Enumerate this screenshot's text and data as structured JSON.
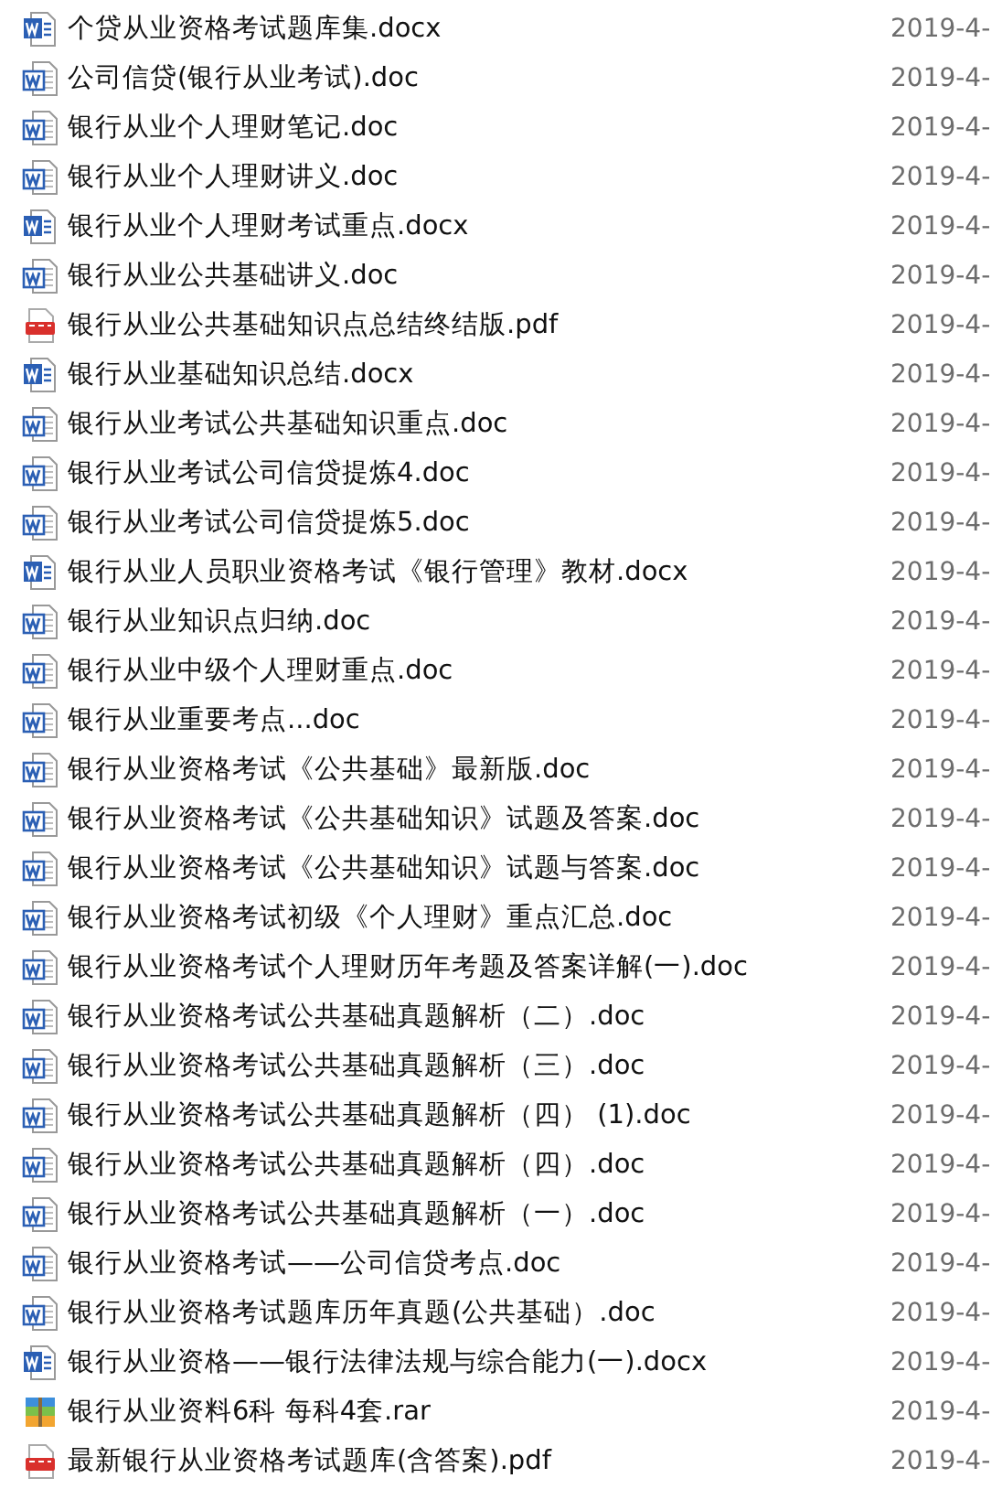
{
  "files": [
    {
      "kind": "docx",
      "name": "个贷从业资格考试题库集.docx",
      "date": "2019-4-"
    },
    {
      "kind": "doc",
      "name": "公司信贷(银行从业考试).doc",
      "date": "2019-4-"
    },
    {
      "kind": "doc",
      "name": "银行从业个人理财笔记.doc",
      "date": "2019-4-"
    },
    {
      "kind": "doc",
      "name": "银行从业个人理财讲义.doc",
      "date": "2019-4-"
    },
    {
      "kind": "docx",
      "name": "银行从业个人理财考试重点.docx",
      "date": "2019-4-"
    },
    {
      "kind": "doc",
      "name": "银行从业公共基础讲义.doc",
      "date": "2019-4-"
    },
    {
      "kind": "pdf",
      "name": "银行从业公共基础知识点总结终结版.pdf",
      "date": "2019-4-"
    },
    {
      "kind": "docx",
      "name": "银行从业基础知识总结.docx",
      "date": "2019-4-"
    },
    {
      "kind": "doc",
      "name": "银行从业考试公共基础知识重点.doc",
      "date": "2019-4-"
    },
    {
      "kind": "doc",
      "name": "银行从业考试公司信贷提炼4.doc",
      "date": "2019-4-"
    },
    {
      "kind": "doc",
      "name": "银行从业考试公司信贷提炼5.doc",
      "date": "2019-4-"
    },
    {
      "kind": "docx",
      "name": "银行从业人员职业资格考试《银行管理》教材.docx",
      "date": "2019-4-"
    },
    {
      "kind": "doc",
      "name": "银行从业知识点归纳.doc",
      "date": "2019-4-"
    },
    {
      "kind": "doc",
      "name": "银行从业中级个人理财重点.doc",
      "date": "2019-4-"
    },
    {
      "kind": "doc",
      "name": "银行从业重要考点...doc",
      "date": "2019-4-"
    },
    {
      "kind": "doc",
      "name": "银行从业资格考试《公共基础》最新版.doc",
      "date": "2019-4-"
    },
    {
      "kind": "doc",
      "name": "银行从业资格考试《公共基础知识》试题及答案.doc",
      "date": "2019-4-"
    },
    {
      "kind": "doc",
      "name": "银行从业资格考试《公共基础知识》试题与答案.doc",
      "date": "2019-4-"
    },
    {
      "kind": "doc",
      "name": "银行从业资格考试初级《个人理财》重点汇总.doc",
      "date": "2019-4-"
    },
    {
      "kind": "doc",
      "name": "银行从业资格考试个人理财历年考题及答案详解(一).doc",
      "date": "2019-4-"
    },
    {
      "kind": "doc",
      "name": "银行从业资格考试公共基础真题解析（二）.doc",
      "date": "2019-4-"
    },
    {
      "kind": "doc",
      "name": "银行从业资格考试公共基础真题解析（三）.doc",
      "date": "2019-4-"
    },
    {
      "kind": "doc",
      "name": "银行从业资格考试公共基础真题解析（四） (1).doc",
      "date": "2019-4-"
    },
    {
      "kind": "doc",
      "name": "银行从业资格考试公共基础真题解析（四）.doc",
      "date": "2019-4-"
    },
    {
      "kind": "doc",
      "name": "银行从业资格考试公共基础真题解析（一）.doc",
      "date": "2019-4-"
    },
    {
      "kind": "doc",
      "name": "银行从业资格考试——公司信贷考点.doc",
      "date": "2019-4-"
    },
    {
      "kind": "doc",
      "name": "银行从业资格考试题库历年真题(公共基础）.doc",
      "date": "2019-4-"
    },
    {
      "kind": "docx",
      "name": "银行从业资格——银行法律法规与综合能力(一).docx",
      "date": "2019-4-"
    },
    {
      "kind": "rar",
      "name": "银行从业资料6科 每科4套.rar",
      "date": "2019-4-"
    },
    {
      "kind": "pdf",
      "name": "最新银行从业资格考试题库(含答案).pdf",
      "date": "2019-4-"
    }
  ]
}
